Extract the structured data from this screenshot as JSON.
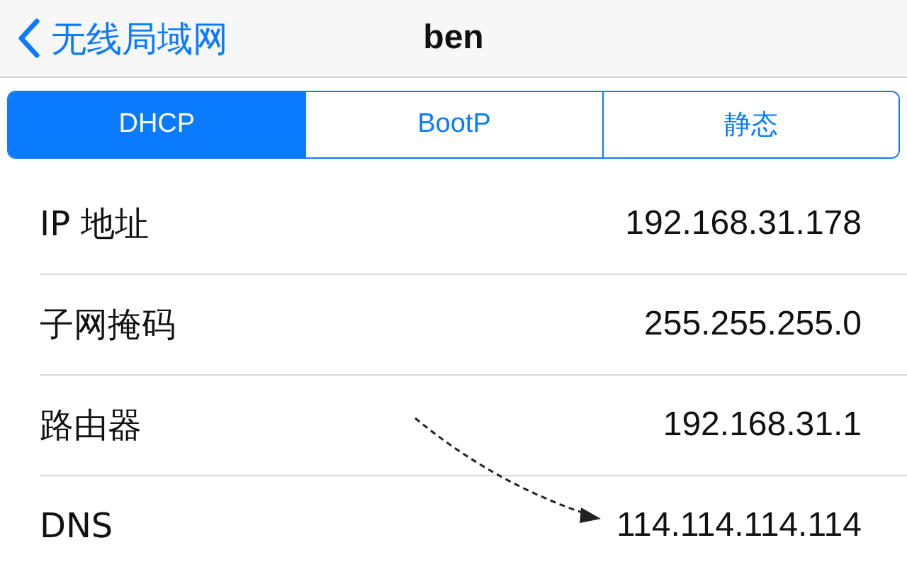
{
  "nav": {
    "back_label": "无线局域网",
    "title": "ben"
  },
  "segments": [
    {
      "label": "DHCP",
      "selected": true
    },
    {
      "label": "BootP",
      "selected": false
    },
    {
      "label": "静态",
      "selected": false
    }
  ],
  "rows": [
    {
      "label": "IP 地址",
      "value": "192.168.31.178"
    },
    {
      "label": "子网掩码",
      "value": "255.255.255.0"
    },
    {
      "label": "路由器",
      "value": "192.168.31.1"
    },
    {
      "label": "DNS",
      "value": "114.114.114.114"
    }
  ]
}
